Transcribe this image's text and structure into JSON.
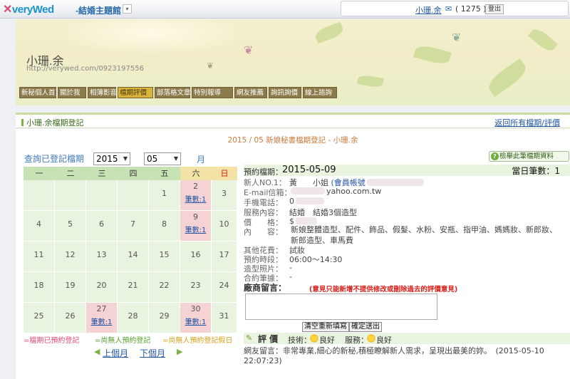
{
  "topbar": {
    "logo_icon": "x-logo-icon",
    "logo_text": "veryWed",
    "site_name": "-結婚主題館",
    "user_name": "小珊.余",
    "mail_icon": "envelope-icon",
    "message_count": "( 1275 )",
    "logout_label": "登出"
  },
  "header": {
    "owner_name": "小珊.余",
    "url": "http://verywed.com/0923197556",
    "nav": [
      "新秘個人首頁",
      "關於我",
      "相簿影音",
      "檔期評價",
      "部落格文章",
      "特別報導",
      "網友推薦",
      "詢訊詢價",
      "線上諮詢"
    ],
    "active_nav": "檔期評價"
  },
  "section": {
    "title": "小珊.余檔期登記",
    "back_link": "返回所有檔期/評價"
  },
  "main": {
    "heading_prefix": "2015 / 05 新娘秘書檔期登記 - ",
    "heading_name": "小珊.余",
    "query_label": "查詢已登記檔期",
    "year": "2015",
    "year_unit": "年",
    "month": "05",
    "month_unit": "月",
    "help_button": "檢舉此筆檔期資料"
  },
  "calendar": {
    "weekdays": [
      "一",
      "二",
      "三",
      "四",
      "五",
      "六",
      "日"
    ],
    "weeks": [
      [
        {
          "d": ""
        },
        {
          "d": ""
        },
        {
          "d": ""
        },
        {
          "d": ""
        },
        {
          "d": "1"
        },
        {
          "d": "2",
          "c": "筆數:1"
        },
        {
          "d": "3"
        }
      ],
      [
        {
          "d": "4"
        },
        {
          "d": "5"
        },
        {
          "d": "6"
        },
        {
          "d": "7"
        },
        {
          "d": "8"
        },
        {
          "d": "9",
          "c": "筆數:1"
        },
        {
          "d": "10"
        }
      ],
      [
        {
          "d": "11"
        },
        {
          "d": "12"
        },
        {
          "d": "13"
        },
        {
          "d": "14"
        },
        {
          "d": "15"
        },
        {
          "d": "16"
        },
        {
          "d": "17"
        }
      ],
      [
        {
          "d": "18"
        },
        {
          "d": "19"
        },
        {
          "d": "20"
        },
        {
          "d": "21"
        },
        {
          "d": "22"
        },
        {
          "d": "23"
        },
        {
          "d": "24"
        }
      ],
      [
        {
          "d": "25"
        },
        {
          "d": "26"
        },
        {
          "d": "27",
          "c": "筆數:1"
        },
        {
          "d": "28"
        },
        {
          "d": "29"
        },
        {
          "d": "30",
          "c": "筆數:1"
        },
        {
          "d": "31"
        }
      ]
    ],
    "legend": [
      {
        "label": "=檔期已預約登記",
        "color": "#e04a7a"
      },
      {
        "label": "=尚無人預約登記",
        "color": "#5aa02c"
      },
      {
        "label": "=尚無人預約登記假日",
        "color": "#d4a017"
      }
    ],
    "prev_month": "上個月",
    "next_month": "下個月"
  },
  "detail": {
    "date_label": "預約檔期：",
    "date_value": "2015-05-09",
    "day_count": "當日筆數：1",
    "rows": [
      {
        "k": "新人NO.1：",
        "v": "黃　　小姐",
        "v2": "(會員帳號"
      },
      {
        "k": "E-mail信箱：",
        "v": "",
        "v2": "yahoo.com.tw"
      },
      {
        "k": "手機電話：",
        "v": "0"
      },
      {
        "k": "服務內容：",
        "v": "結婚　結婚3個造型"
      },
      {
        "k": "價　　格：",
        "v": "$"
      },
      {
        "k": "內　　容："
      }
    ],
    "service_detail": "新娘整體造型、配件、飾品、假髮、水粉、安瓶、指甲油、媽媽妝、新郎妝、新郎造型、車馬費",
    "extra_rows": [
      {
        "k": "其他花費：",
        "v": "試妝"
      },
      {
        "k": "預約時段：",
        "v": "06:00～14:30"
      },
      {
        "k": "造型照片：",
        "v": "-"
      },
      {
        "k": "合約筆據：",
        "v": "-"
      }
    ],
    "message_heading": "廠商留言：",
    "message_note": "(意見只能新增不提供修改或刪除過去的評價意見)",
    "clear_button": "清空重新填寫",
    "submit_button": "確定送出",
    "rating_title": "評 價",
    "rating_tech_label": "技術：",
    "rating_tech_value": "良好",
    "rating_service_label": "服務：",
    "rating_service_value": "良好",
    "review_text": "網友留言：非常專業,細心的新秘,積極瞭解新人需求，呈現出最美的妳。",
    "review_time": "(2015-05-10 22:07:23)"
  }
}
